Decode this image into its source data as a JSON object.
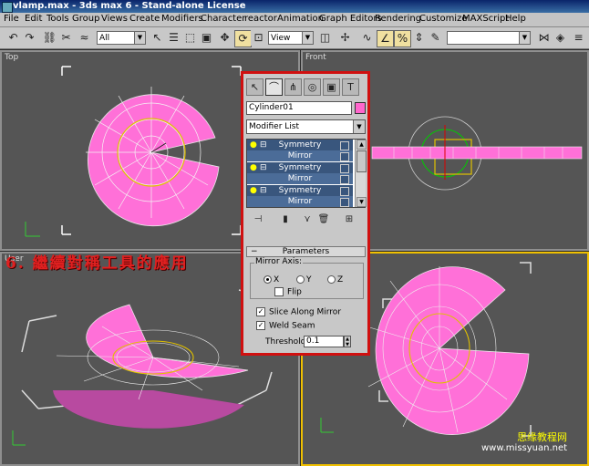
{
  "window": {
    "title": "vlamp.max - 3ds max 6 - Stand-alone License"
  },
  "menu": [
    "File",
    "Edit",
    "Tools",
    "Group",
    "Views",
    "Create",
    "Modifiers",
    "Character",
    "reactor",
    "Animation",
    "Graph Editors",
    "Rendering",
    "Customize",
    "MAXScript",
    "Help"
  ],
  "toolbar": {
    "selection_filter": "All",
    "ref_coord": "View",
    "named_selection": ""
  },
  "viewports": {
    "top": "Top",
    "front": "Front",
    "user": "User"
  },
  "caption": "6.  繼續對稱工具的應用",
  "panel": {
    "object_name": "Cylinder01",
    "object_color": "#ff66cc",
    "modifier_list": "Modifier List",
    "stack": [
      {
        "name": "Symmetry",
        "sub": false
      },
      {
        "name": "Mirror",
        "sub": true
      },
      {
        "name": "Symmetry",
        "sub": false
      },
      {
        "name": "Mirror",
        "sub": true
      },
      {
        "name": "Symmetry",
        "sub": false
      },
      {
        "name": "Mirror",
        "sub": true
      }
    ],
    "rollout_title": "Parameters",
    "mirror_axis_label": "Mirror Axis:",
    "axis": {
      "x": "X",
      "y": "Y",
      "z": "Z",
      "selected": "X"
    },
    "flip_label": "Flip",
    "slice_label": "Slice Along Mirror",
    "weld_label": "Weld Seam",
    "threshold_label": "Threshold:",
    "threshold_value": "0.1"
  },
  "watermark": {
    "line1": "思缘教程网",
    "line2": "www.missyuan.net"
  }
}
